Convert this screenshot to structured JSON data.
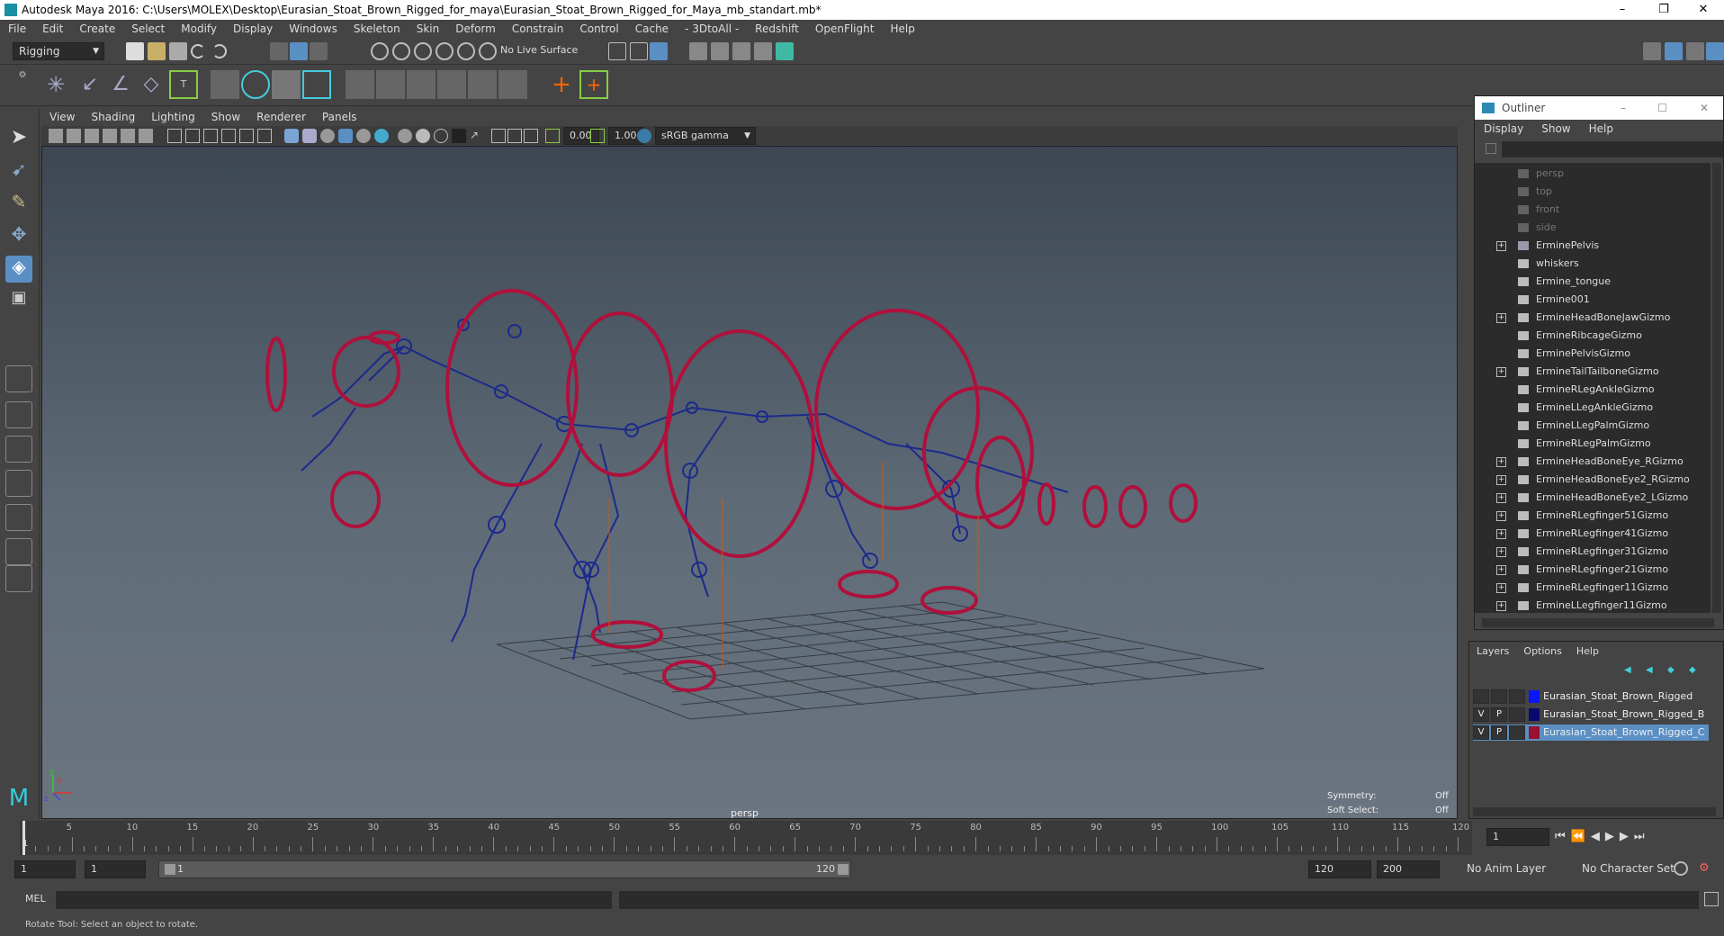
{
  "window": {
    "title": "Autodesk Maya 2016: C:\\Users\\MOLEX\\Desktop\\Eurasian_Stoat_Brown_Rigged_for_maya\\Eurasian_Stoat_Brown_Rigged_for_Maya_mb_standart.mb*",
    "controls": [
      "–",
      "❐",
      "✕"
    ]
  },
  "menubar": [
    "File",
    "Edit",
    "Create",
    "Select",
    "Modify",
    "Display",
    "Windows",
    "Skeleton",
    "Skin",
    "Deform",
    "Constrain",
    "Control",
    "Cache",
    "- 3DtoAll -",
    "Redshift",
    "OpenFlight",
    "Help"
  ],
  "statusline": {
    "mode": "Rigging",
    "live_surface": "No Live Surface"
  },
  "panel": {
    "menus": [
      "View",
      "Shading",
      "Lighting",
      "Show",
      "Renderer",
      "Panels"
    ],
    "exposure": "0.00",
    "gamma": "1.00",
    "color_space": "sRGB gamma"
  },
  "viewport": {
    "camera_label": "persp",
    "hud": [
      {
        "label": "Symmetry:",
        "value": "Off"
      },
      {
        "label": "Soft Select:",
        "value": "Off"
      }
    ],
    "axis_labels": [
      "x",
      "y",
      "z"
    ]
  },
  "outliner": {
    "title": "Outliner",
    "menus": [
      "Display",
      "Show",
      "Help"
    ],
    "items": [
      {
        "label": "persp",
        "icon": "camera-icon",
        "expandable": false,
        "dim": true
      },
      {
        "label": "top",
        "icon": "camera-icon",
        "expandable": false,
        "dim": true
      },
      {
        "label": "front",
        "icon": "camera-icon",
        "expandable": false,
        "dim": true
      },
      {
        "label": "side",
        "icon": "camera-icon",
        "expandable": false,
        "dim": true
      },
      {
        "label": "ErminePelvis",
        "icon": "joint-icon",
        "expandable": true,
        "dim": false
      },
      {
        "label": "whiskers",
        "icon": "transform-icon",
        "expandable": false,
        "dim": false
      },
      {
        "label": "Ermine_tongue",
        "icon": "transform-icon",
        "expandable": false,
        "dim": false
      },
      {
        "label": "Ermine001",
        "icon": "transform-icon",
        "expandable": false,
        "dim": false
      },
      {
        "label": "ErmineHeadBoneJawGizmo",
        "icon": "transform-icon",
        "expandable": true,
        "dim": false
      },
      {
        "label": "ErmineRibcageGizmo",
        "icon": "transform-icon",
        "expandable": false,
        "dim": false
      },
      {
        "label": "ErminePelvisGizmo",
        "icon": "transform-icon",
        "expandable": false,
        "dim": false
      },
      {
        "label": "ErmineTailTailboneGizmo",
        "icon": "transform-icon",
        "expandable": true,
        "dim": false
      },
      {
        "label": "ErmineRLegAnkleGizmo",
        "icon": "transform-icon",
        "expandable": false,
        "dim": false
      },
      {
        "label": "ErmineLLegAnkleGizmo",
        "icon": "transform-icon",
        "expandable": false,
        "dim": false
      },
      {
        "label": "ErmineLLegPalmGizmo",
        "icon": "transform-icon",
        "expandable": false,
        "dim": false
      },
      {
        "label": "ErmineRLegPalmGizmo",
        "icon": "transform-icon",
        "expandable": false,
        "dim": false
      },
      {
        "label": "ErmineHeadBoneEye_RGizmo",
        "icon": "transform-icon",
        "expandable": true,
        "dim": false
      },
      {
        "label": "ErmineHeadBoneEye2_RGizmo",
        "icon": "transform-icon",
        "expandable": true,
        "dim": false
      },
      {
        "label": "ErmineHeadBoneEye2_LGizmo",
        "icon": "transform-icon",
        "expandable": true,
        "dim": false
      },
      {
        "label": "ErmineRLegfinger51Gizmo",
        "icon": "transform-icon",
        "expandable": true,
        "dim": false
      },
      {
        "label": "ErmineRLegfinger41Gizmo",
        "icon": "transform-icon",
        "expandable": true,
        "dim": false
      },
      {
        "label": "ErmineRLegfinger31Gizmo",
        "icon": "transform-icon",
        "expandable": true,
        "dim": false
      },
      {
        "label": "ErmineRLegfinger21Gizmo",
        "icon": "transform-icon",
        "expandable": true,
        "dim": false
      },
      {
        "label": "ErmineRLegfinger11Gizmo",
        "icon": "transform-icon",
        "expandable": true,
        "dim": false
      },
      {
        "label": "ErmineLLegfinger11Gizmo",
        "icon": "transform-icon",
        "expandable": true,
        "dim": false
      }
    ]
  },
  "layers": {
    "menus": [
      "Layers",
      "Options",
      "Help"
    ],
    "rows": [
      {
        "v": "",
        "p": "",
        "color": "#0a14ff",
        "name": "Eurasian_Stoat_Brown_Rigged",
        "selected": false
      },
      {
        "v": "V",
        "p": "P",
        "color": "#0a0a6e",
        "name": "Eurasian_Stoat_Brown_Rigged_B",
        "selected": false
      },
      {
        "v": "V",
        "p": "P",
        "color": "#9a1030",
        "name": "Eurasian_Stoat_Brown_Rigged_C",
        "selected": true
      }
    ]
  },
  "timeline": {
    "ticks": [
      "5",
      "10",
      "15",
      "20",
      "25",
      "30",
      "35",
      "40",
      "45",
      "50",
      "55",
      "60",
      "65",
      "70",
      "75",
      "80",
      "85",
      "90",
      "95",
      "100",
      "105",
      "110",
      "115",
      "120"
    ],
    "start_label": "1",
    "current_frame": "1"
  },
  "range": {
    "start": "1",
    "playback_start": "1",
    "slider_start": "1",
    "slider_end": "120",
    "playback_end": "120",
    "end": "200",
    "anim_layer": "No Anim Layer",
    "character_set": "No Character Set"
  },
  "cmdline": {
    "label": "MEL"
  },
  "helpline": {
    "text": "Rotate Tool: Select an object to rotate."
  }
}
